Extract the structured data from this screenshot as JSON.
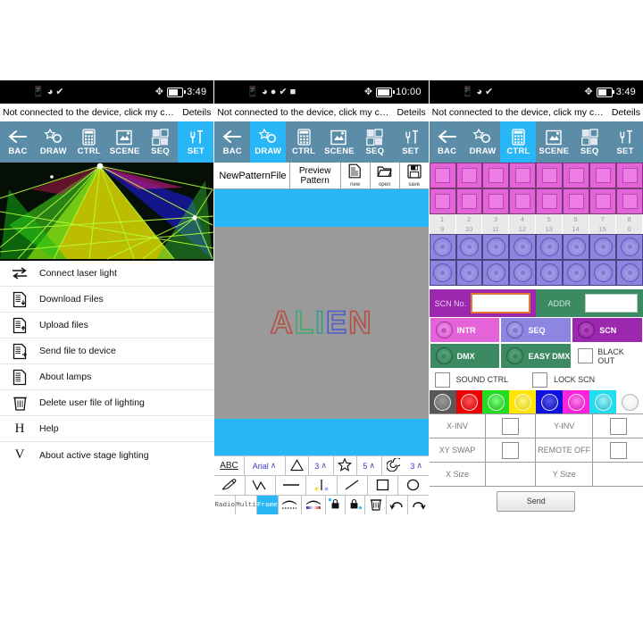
{
  "app": {
    "notice_text": "Not connected to the device, click my connectio...",
    "details_label": "Deteils"
  },
  "status_bars": [
    {
      "time": "3:49",
      "icons": [
        "sim-icon",
        "wifi-icon",
        "shield-icon"
      ],
      "right_icons": [
        "bluetooth-icon",
        "battery-icon"
      ]
    },
    {
      "time": "10:00",
      "icons": [
        "sim-icon",
        "wifi-icon",
        "location-icon",
        "shield-icon",
        "sd-icon"
      ],
      "right_icons": [
        "bluetooth-icon",
        "battery-icon"
      ]
    },
    {
      "time": "3:49",
      "icons": [
        "sim-icon",
        "wifi-icon",
        "shield-icon"
      ],
      "right_icons": [
        "bluetooth-icon",
        "battery-icon"
      ]
    }
  ],
  "nav": {
    "tabs": [
      {
        "label": "BAC",
        "icon": "back-arrow-icon"
      },
      {
        "label": "DRAW",
        "icon": "star-circle-icon"
      },
      {
        "label": "CTRL",
        "icon": "keypad-icon"
      },
      {
        "label": "SCENE",
        "icon": "scene-icon"
      },
      {
        "label": "SEQ",
        "icon": "sequence-icon"
      },
      {
        "label": "SET",
        "icon": "tools-icon"
      }
    ],
    "active": [
      5,
      1,
      2
    ],
    "bg_color": "#5b8ca8",
    "active_color": "#29b6f6"
  },
  "panel1": {
    "hero_alt": "laser-light-show-photo",
    "menu": [
      {
        "label": "Connect laser light",
        "icon": "transfer-arrows-icon"
      },
      {
        "label": "Download Files",
        "icon": "document-download-icon"
      },
      {
        "label": "Upload files",
        "icon": "document-upload-icon"
      },
      {
        "label": "Send file to device",
        "icon": "document-send-icon"
      },
      {
        "label": "About lamps",
        "icon": "document-icon"
      },
      {
        "label": "Delete user file of lighting",
        "icon": "trash-icon"
      },
      {
        "label": "Help",
        "icon": "letter-h-icon",
        "glyph": "H"
      },
      {
        "label": "About active stage lighting",
        "icon": "letter-v-icon",
        "glyph": "V"
      }
    ]
  },
  "panel2": {
    "file_name": "NewPatternFile",
    "preview_label": "Preview\nPattern",
    "preview_line1": "Preview",
    "preview_line2": "Pattern",
    "buttons": [
      {
        "caption": "new",
        "icon": "new-document-icon"
      },
      {
        "caption": "open",
        "icon": "open-folder-icon"
      },
      {
        "caption": "save",
        "icon": "floppy-save-icon"
      }
    ],
    "canvas": {
      "text": "ALIEN",
      "letters": [
        {
          "char": "A",
          "color": "#c0392b"
        },
        {
          "char": "L",
          "color": "#27ae60"
        },
        {
          "char": "I",
          "color": "#16a085"
        },
        {
          "char": "E",
          "color": "#3b4bd8"
        },
        {
          "char": "N",
          "color": "#c0392b"
        }
      ],
      "bg_color": "#9a9a9a",
      "band_color": "#29b6f6"
    },
    "toolbar_row1": [
      {
        "name": "text-tool",
        "label": "ABC"
      },
      {
        "name": "font-select",
        "label": "Arial",
        "chevron": "∧"
      },
      {
        "name": "polygon-tool",
        "icon": "triangle-icon"
      },
      {
        "name": "polygon-sides",
        "value": "3",
        "chevron": "∧"
      },
      {
        "name": "star-tool",
        "icon": "star-icon"
      },
      {
        "name": "star-points",
        "value": "5",
        "chevron": "∧"
      },
      {
        "name": "spiral-tool",
        "icon": "spiral-icon"
      },
      {
        "name": "spiral-turns",
        "value": "3",
        "chevron": "∧"
      }
    ],
    "toolbar_row2": [
      {
        "name": "pencil-tool",
        "icon": "pencil-icon"
      },
      {
        "name": "polyline-tool",
        "icon": "polyline-icon"
      },
      {
        "name": "line-tool",
        "icon": "horizontal-line-icon"
      },
      {
        "name": "point-tool",
        "icon": "points-icon"
      },
      {
        "name": "diagonal-line-tool",
        "icon": "diagonal-line-icon"
      },
      {
        "name": "rectangle-tool",
        "icon": "square-icon"
      },
      {
        "name": "ellipse-tool",
        "icon": "circle-icon"
      }
    ],
    "toolbar_row3": [
      {
        "name": "radio-mode",
        "label": "Radio"
      },
      {
        "name": "multi-mode",
        "label": "Multi"
      },
      {
        "name": "frame-mode",
        "label": "Frame",
        "active": true
      },
      {
        "name": "dotted-fill",
        "icon": "dotted-arc-icon"
      },
      {
        "name": "gradient-fill",
        "icon": "gradient-arc-icon"
      },
      {
        "name": "lock-add",
        "icon": "lock-plus-icon"
      },
      {
        "name": "lock-remove",
        "icon": "lock-minus-icon"
      },
      {
        "name": "delete",
        "icon": "trash-icon"
      },
      {
        "name": "undo",
        "icon": "undo-arrow-icon"
      },
      {
        "name": "redo",
        "icon": "redo-arrow-icon"
      }
    ]
  },
  "panel3": {
    "pink_grid_rows": 2,
    "pink_grid_cols": 8,
    "number_row_1": [
      "1",
      "2",
      "3",
      "4",
      "5",
      "6",
      "7",
      "8"
    ],
    "number_row_2": [
      "9",
      "10",
      "11",
      "12",
      "13",
      "14",
      "15",
      "0"
    ],
    "purple_grid_rows": 2,
    "purple_grid_cols": 8,
    "scn_no_label": "SCN No.",
    "scn_no_value": "",
    "addr_label": "ADDR",
    "addr_value": "",
    "mode_buttons": [
      {
        "label": "INTR",
        "bg": "#e563d8",
        "knob": "#e563d8"
      },
      {
        "label": "SEQ",
        "bg": "#8d86e0",
        "knob": "#8d86e0"
      },
      {
        "label": "SCN",
        "bg": "#9c28b0",
        "knob": "#9c28b0"
      },
      {
        "label": "DMX",
        "bg": "#3c8a62",
        "knob": "#3c8a62"
      },
      {
        "label": "EASY DMX",
        "bg": "#3c8a62",
        "knob": "#3c8a62"
      }
    ],
    "black_out_label": "BLACK OUT",
    "sound_ctrl_label": "SOUND CTRL",
    "lock_scn_label": "LOCK SCN",
    "palette": [
      "#585858",
      "#ee0000",
      "#22dd22",
      "#ffe500",
      "#1111dd",
      "#ff22dd",
      "#22ddee",
      "#ffffff"
    ],
    "options": [
      {
        "label_left": "X-INV",
        "label_right": "Y-INV",
        "type": "checkbox"
      },
      {
        "label_left": "XY SWAP",
        "label_right": "REMOTE OFF",
        "type": "checkbox"
      },
      {
        "label_left": "X Size",
        "label_right": "Y Size",
        "type": "field"
      }
    ],
    "send_label": "Send"
  }
}
